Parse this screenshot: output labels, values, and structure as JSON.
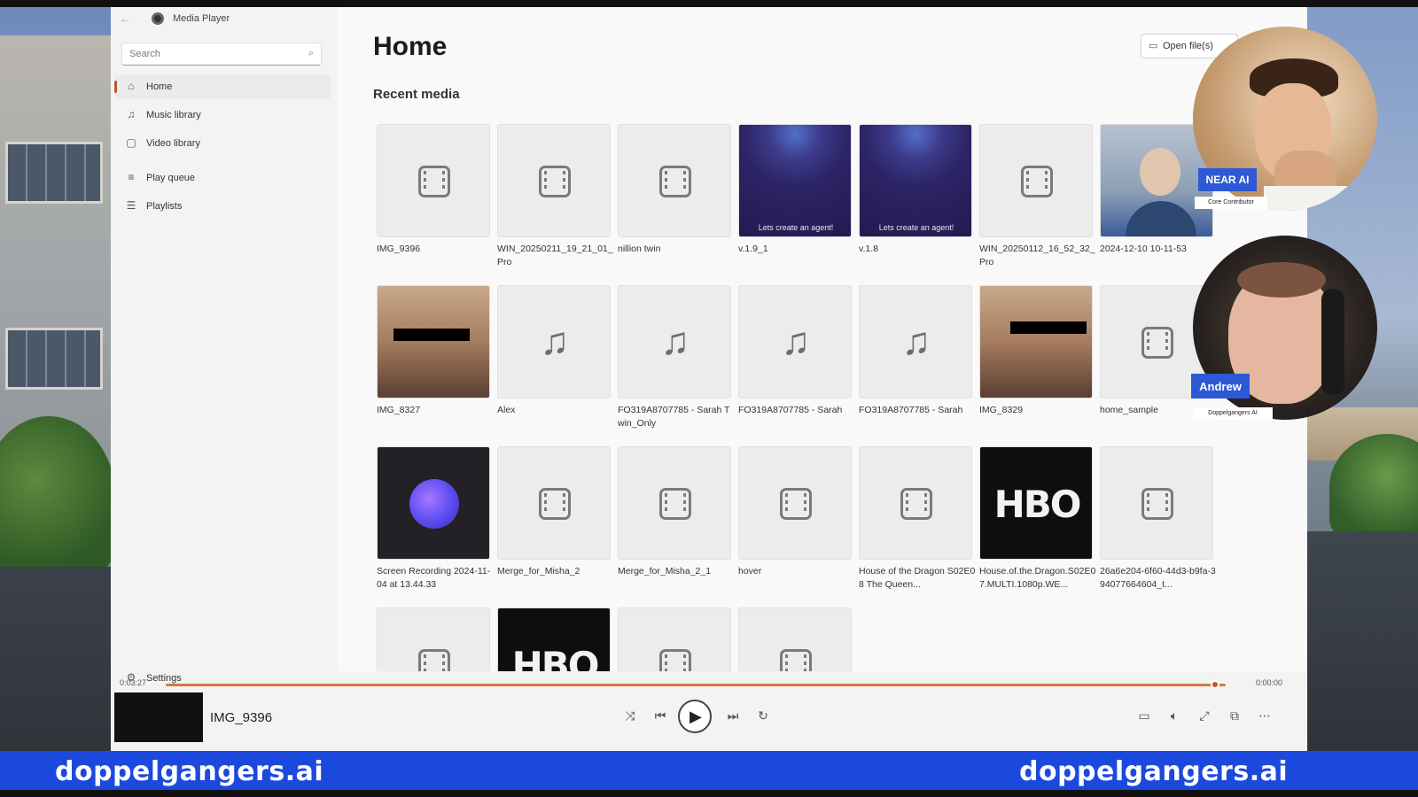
{
  "window": {
    "app_title": "Media Player",
    "controls": {
      "minimize": "—",
      "maximize": "▢",
      "close": "✕"
    }
  },
  "sidebar": {
    "search_placeholder": "Search",
    "items": [
      {
        "label": "Home",
        "icon": "home-icon",
        "active": true
      },
      {
        "label": "Music library",
        "icon": "music-note-icon"
      },
      {
        "label": "Video library",
        "icon": "video-icon"
      },
      {
        "label": "Play queue",
        "icon": "queue-icon"
      },
      {
        "label": "Playlists",
        "icon": "playlist-icon"
      }
    ],
    "settings_label": "Settings"
  },
  "main": {
    "title": "Home",
    "section": "Recent media",
    "open_file_label": "Open file(s)"
  },
  "tiles": [
    {
      "label": "IMG_9396",
      "kind": "video"
    },
    {
      "label": "WIN_20250211_19_21_01_Pro",
      "kind": "video"
    },
    {
      "label": "nillion twin",
      "kind": "video"
    },
    {
      "label": "v.1.9_1",
      "kind": "agent",
      "thumb_text": "Lets create an agent!"
    },
    {
      "label": "v.1.8",
      "kind": "agent",
      "thumb_text": "Lets create an agent!"
    },
    {
      "label": "WIN_20250112_16_52_32_Pro",
      "kind": "video"
    },
    {
      "label": "2024-12-10 10-11-53",
      "kind": "call"
    },
    {
      "label": "IMG_8327",
      "kind": "photo"
    },
    {
      "label": "Alex",
      "kind": "music"
    },
    {
      "label": "FO319A8707785 - Sarah Twin_Only",
      "kind": "music"
    },
    {
      "label": "FO319A8707785 - Sarah",
      "kind": "music"
    },
    {
      "label": "FO319A8707785 - Sarah",
      "kind": "music"
    },
    {
      "label": "IMG_8329",
      "kind": "photo"
    },
    {
      "label": "home_sample",
      "kind": "video"
    },
    {
      "label": "Screen Recording 2024-11-04 at 13.44.33",
      "kind": "blob"
    },
    {
      "label": "Merge_for_Misha_2",
      "kind": "video"
    },
    {
      "label": "Merge_for_Misha_2_1",
      "kind": "video"
    },
    {
      "label": "hover",
      "kind": "video"
    },
    {
      "label": "House of the Dragon S02E08 The Queen...",
      "kind": "video"
    },
    {
      "label": "House.of.the.Dragon.S02E07.MULTI.1080p.WE...",
      "kind": "hbo",
      "thumb_text": "HBO"
    },
    {
      "label": "26a6e204-6f60-44d3-b9fa-394077664604_t...",
      "kind": "video"
    },
    {
      "label": "",
      "kind": "video"
    },
    {
      "label": "",
      "kind": "hbo",
      "thumb_text": "HBO"
    },
    {
      "label": "",
      "kind": "video"
    },
    {
      "label": "",
      "kind": "video"
    }
  ],
  "player": {
    "elapsed": "0:03:27",
    "remaining": "0:00:00",
    "progress": 0.99,
    "now_playing": "IMG_9396",
    "accent": "#c0542b"
  },
  "overlays": {
    "cam1_name": "NEAR AI",
    "cam1_role": "Core Contributor",
    "cam2_name": "Andrew",
    "cam2_role": "Doppelgangers AI"
  },
  "banner": {
    "left": "doppelgangers.ai",
    "right": "doppelgangers.ai",
    "color": "#1c49dd"
  }
}
